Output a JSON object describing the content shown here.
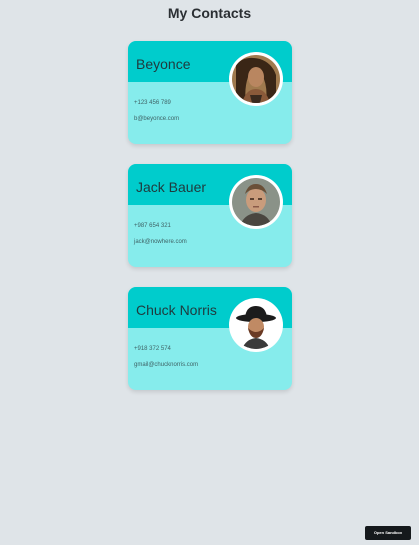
{
  "page": {
    "title": "My Contacts",
    "background": "#dfe4e8"
  },
  "colors": {
    "card_header": "#00cccc",
    "card_body": "#86ecec",
    "text_dark": "#1f3a3d"
  },
  "contacts": [
    {
      "name": "Beyonce",
      "phone": "+123 456 789",
      "email": "b@beyonce.com",
      "avatar_icon": "person-photo-icon"
    },
    {
      "name": "Jack Bauer",
      "phone": "+987 654 321",
      "email": "jack@nowhere.com",
      "avatar_icon": "person-photo-icon"
    },
    {
      "name": "Chuck Norris",
      "phone": "+918 372 574",
      "email": "gmail@chucknorris.com",
      "avatar_icon": "person-photo-icon"
    }
  ],
  "footer": {
    "sandbox_label": "Open Sandbox"
  }
}
